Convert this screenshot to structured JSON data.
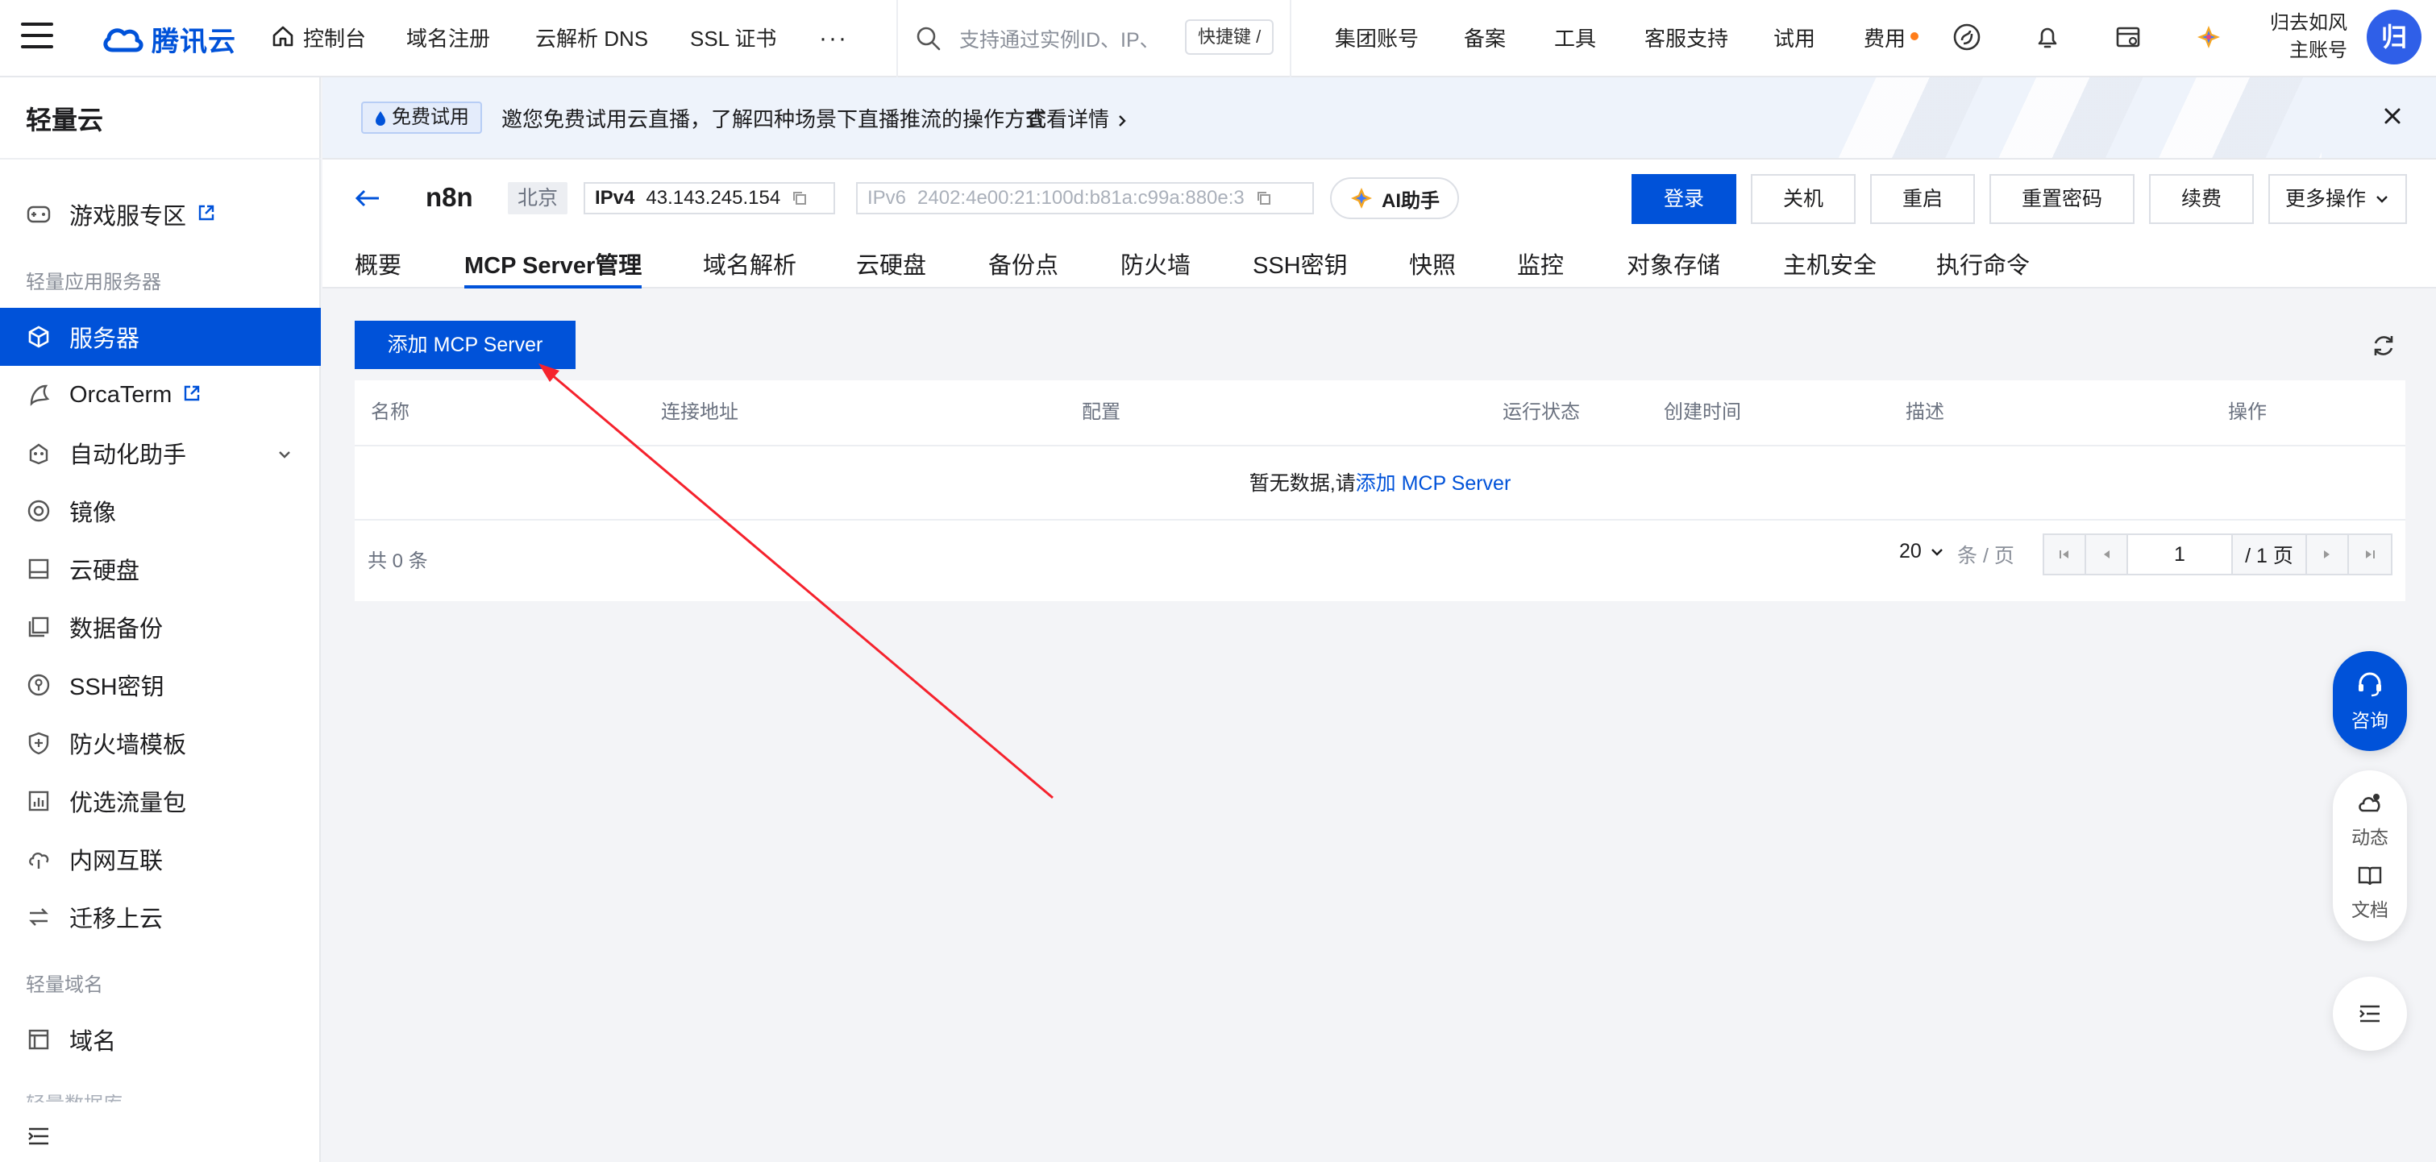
{
  "topbar": {
    "brand": "腾讯云",
    "console": "控制台",
    "nav": [
      "域名注册",
      "云解析 DNS",
      "SSL 证书"
    ],
    "more": "···",
    "search_placeholder": "支持通过实例ID、IP、",
    "shortcut": "快捷键 /",
    "right_nav": [
      "集团账号",
      "备案",
      "工具",
      "客服支持",
      "试用",
      "费用"
    ],
    "user_name": "归去如风",
    "user_role": "主账号",
    "avatar_letter": "归"
  },
  "sidebar": {
    "title": "轻量云",
    "items_top": [
      {
        "label": "游戏服专区"
      }
    ],
    "section1": "轻量应用服务器",
    "items": [
      {
        "label": "服务器"
      },
      {
        "label": "OrcaTerm"
      },
      {
        "label": "自动化助手"
      },
      {
        "label": "镜像"
      },
      {
        "label": "云硬盘"
      },
      {
        "label": "数据备份"
      },
      {
        "label": "SSH密钥"
      },
      {
        "label": "防火墙模板"
      },
      {
        "label": "优选流量包"
      },
      {
        "label": "内网互联"
      },
      {
        "label": "迁移上云"
      }
    ],
    "section2": "轻量域名",
    "domain_item": "域名",
    "section3_partial": "轻量数据库"
  },
  "banner": {
    "badge": "免费试用",
    "text": "邀您免费试用云直播，了解四种场景下直播推流的操作方式",
    "link": "查看详情"
  },
  "instance": {
    "name": "n8n",
    "region": "北京",
    "ipv4_label": "IPv4",
    "ipv4": "43.143.245.154",
    "ipv6_label": "IPv6",
    "ipv6": "2402:4e00:21:100d:b81a:c99a:880e:3",
    "ai_label": "AI助手",
    "actions": [
      "登录",
      "关机",
      "重启",
      "重置密码",
      "续费",
      "更多操作"
    ],
    "tabs": [
      "概要",
      "MCP Server管理",
      "域名解析",
      "云硬盘",
      "备份点",
      "防火墙",
      "SSH密钥",
      "快照",
      "监控",
      "对象存储",
      "主机安全",
      "执行命令"
    ],
    "active_tab": "MCP Server管理"
  },
  "content": {
    "add_button": "添加 MCP Server",
    "columns": [
      "名称",
      "连接地址",
      "配置",
      "运行状态",
      "创建时间",
      "描述",
      "操作"
    ],
    "empty_text": "暂无数据,请",
    "empty_link": "添加 MCP Server",
    "total": "共 0 条",
    "page_size": "20",
    "page_size_unit": "条 / 页",
    "current_page": "1",
    "total_pages": "/ 1 页"
  },
  "float": {
    "consult": "咨询",
    "dynamic": "动态",
    "docs": "文档"
  },
  "colors": {
    "primary": "#0052d9",
    "annotation_arrow": "#f5222d"
  }
}
